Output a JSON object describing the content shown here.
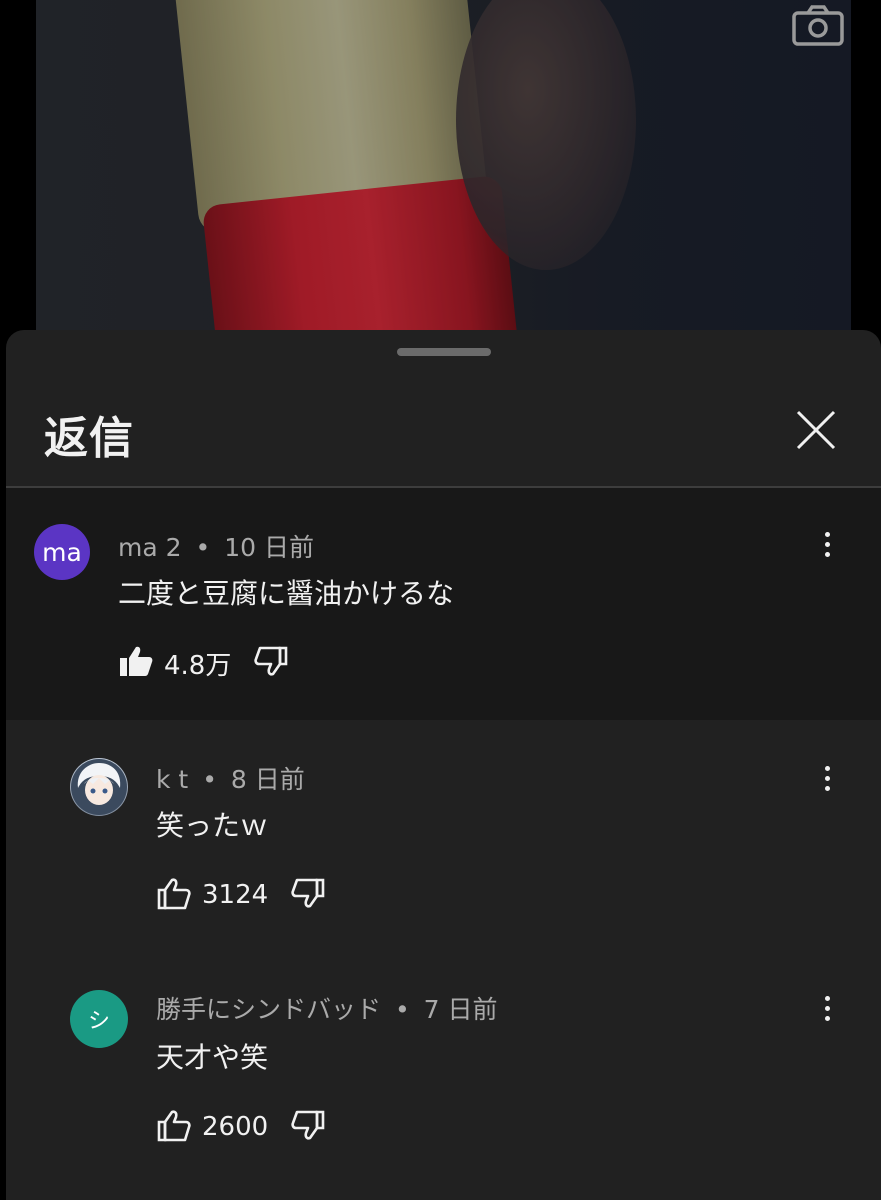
{
  "sheet": {
    "title": "返信"
  },
  "comments": [
    {
      "avatar_text": "ma",
      "avatar_color": "#5b35c4",
      "author": "ma 2",
      "time": "10 日前",
      "text": "二度と豆腐に醤油かけるな",
      "likes": "4.8万",
      "liked": true
    },
    {
      "avatar_text": "",
      "avatar_color": "#c9d3e0",
      "author": "k t",
      "time": "8 日前",
      "text": "笑ったｗ",
      "likes": "3124",
      "liked": false
    },
    {
      "avatar_text": "シ",
      "avatar_color": "#1a9a84",
      "author": "勝手にシンドバッド",
      "time": "7 日前",
      "text": "天才や笑",
      "likes": "2600",
      "liked": false
    }
  ],
  "icons": {
    "camera": "camera-icon",
    "close": "close-icon",
    "like": "thumbs-up-icon",
    "dislike": "thumbs-down-icon",
    "more": "more-vert-icon"
  },
  "separator": "•"
}
